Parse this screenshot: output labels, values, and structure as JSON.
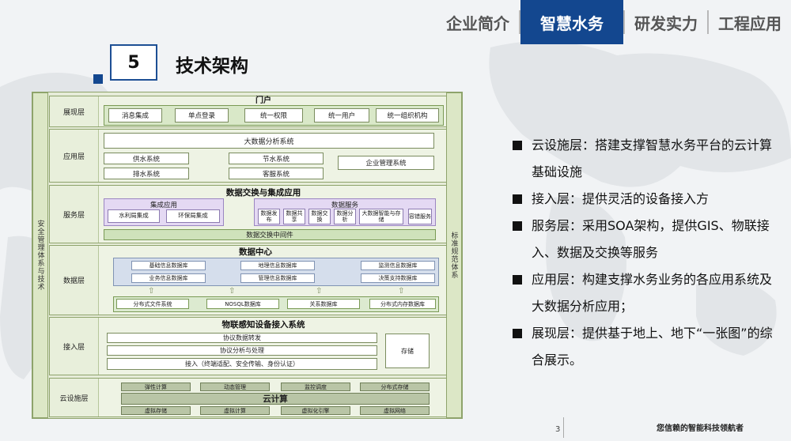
{
  "nav": {
    "items": [
      {
        "label": "企业简介",
        "active": false
      },
      {
        "label": "智慧水务",
        "active": true
      },
      {
        "label": "研发实力",
        "active": false
      },
      {
        "label": "工程应用",
        "active": false
      }
    ]
  },
  "section": {
    "number": "5",
    "title": "技术架构"
  },
  "diagram": {
    "side_left": "安全管理体系与技术",
    "side_right": "标准规范体系",
    "portal_title": "门户",
    "presentation": {
      "label": "展现层",
      "boxes": [
        "消息集成",
        "单点登录",
        "统一权限",
        "统一用户",
        "统一组织机构"
      ]
    },
    "application": {
      "label": "应用层",
      "bigdata": "大数据分析系统",
      "boxes": [
        "供水系统",
        "节水系统",
        "企业管理系统",
        "排水系统",
        "客服系统"
      ]
    },
    "service": {
      "label": "服务层",
      "title": "数据交换与集成应用",
      "integration": {
        "title": "集成应用",
        "items": [
          "水利局集成",
          "环保局集成"
        ]
      },
      "data_service": {
        "title": "数据服务",
        "items": [
          "数据发布",
          "数据共享",
          "数据交换",
          "数据分析",
          "大数据智能与存储",
          "容错服务"
        ]
      },
      "middleware": "数据交换中间件"
    },
    "data": {
      "label": "数据层",
      "title": "数据中心",
      "db_row1": [
        "基础信息数据库",
        "地理信息数据库",
        "监测信息数据库"
      ],
      "db_row2": [
        "业务信息数据库",
        "管理信息数据库",
        "决策支持数据库"
      ],
      "storage": [
        "分布式文件系统",
        "NOSQL数据库",
        "关系数据库",
        "分布式内存数据库"
      ]
    },
    "access": {
      "label": "接入层",
      "title": "物联感知设备接入系统",
      "rows": [
        "协议数据转发",
        "协议分析与处理",
        "接入（终端适配、安全传输、身份认证）"
      ],
      "storage": "存储"
    },
    "cloud": {
      "label": "云设施层",
      "top": [
        "弹性计算",
        "动态管理",
        "监控调度",
        "分布式存储"
      ],
      "title": "云计算",
      "bottom": [
        "虚拟存储",
        "虚拟计算",
        "虚拟化引擎",
        "虚拟网络"
      ]
    }
  },
  "bullets": [
    "云设施层：搭建支撑智慧水务平台的云计算基础设施",
    "接入层：提供灵活的设备接入方",
    "服务层：采用SOA架构，提供GIS、物联接入、数据及交换等服务",
    "应用层：构建支撑水务业务的各应用系统及大数据分析应用；",
    "展现层：提供基于地上、地下“一张图”的综合展示。"
  ],
  "footer": {
    "page": "3",
    "slogan": "您信赖的智能科技领航者"
  },
  "colors": {
    "accent": "#13478f",
    "layer_green": "#cfe2bb",
    "service_purple": "#e4d9f3",
    "data_blue": "#d5deec"
  }
}
